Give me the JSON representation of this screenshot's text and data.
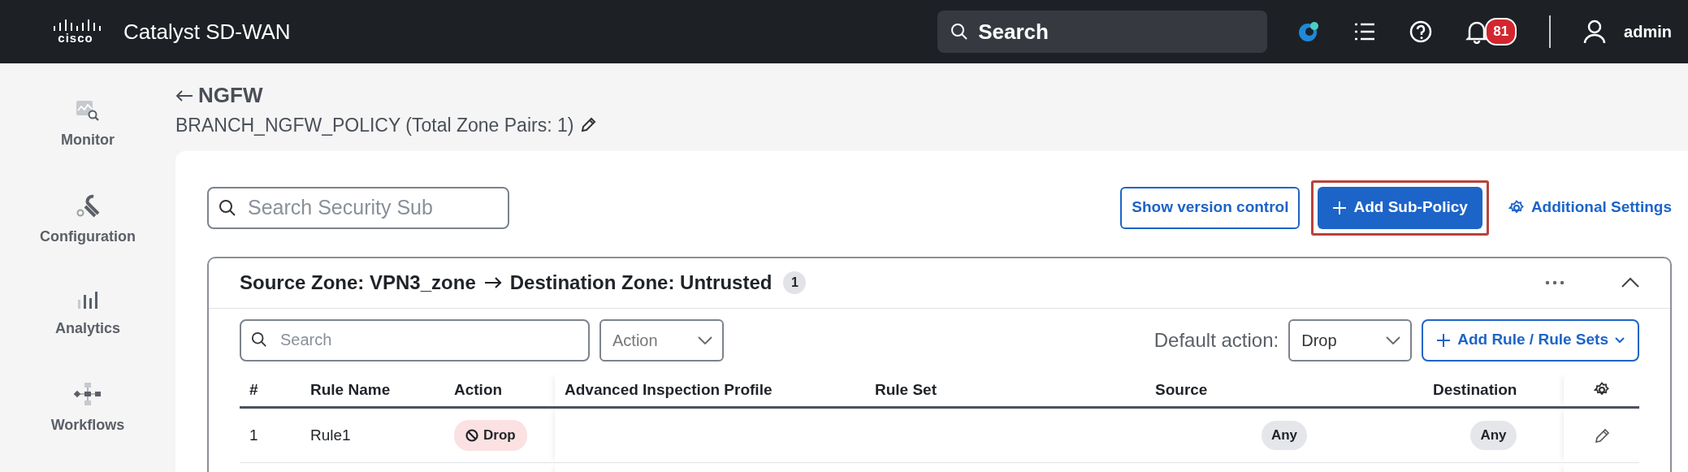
{
  "header": {
    "logo_text": "cisco",
    "brand": "Catalyst SD-WAN",
    "search_placeholder": "Search",
    "notifications": "81",
    "user": "admin"
  },
  "sidebar": {
    "items": [
      {
        "label": "Monitor",
        "kind": "monitor"
      },
      {
        "label": "Configuration",
        "kind": "configuration"
      },
      {
        "label": "Analytics",
        "kind": "analytics"
      },
      {
        "label": "Workflows",
        "kind": "workflows"
      }
    ]
  },
  "page": {
    "title": "NGFW",
    "subtitle": "BRANCH_NGFW_POLICY (Total Zone Pairs: 1)"
  },
  "toolbar": {
    "search_placeholder": "Search Security Sub",
    "buttons": [
      {
        "label": "Show version control",
        "kind": "outline",
        "highlighted": false
      },
      {
        "label": "Add Sub-Policy",
        "kind": "primary",
        "highlighted": true
      }
    ],
    "settings_link": "Additional Settings"
  },
  "zone_pair": {
    "source_label": "Source Zone: VPN3_zone",
    "destination_label": "Destination Zone: Untrusted",
    "count": "1",
    "expanded": true,
    "search_placeholder": "Search",
    "action_filter": "Action",
    "default_action_label": "Default action:",
    "default_action": "Drop",
    "add_button": "Add Rule / Rule Sets",
    "table": {
      "columns": [
        "#",
        "Rule Name",
        "Action",
        "Advanced Inspection Profile",
        "Rule Set",
        "Source",
        "Destination"
      ],
      "rows": [
        {
          "number": "1",
          "rule_name": "Rule1",
          "action": "Drop",
          "source": "Any",
          "destination": "Any"
        }
      ]
    }
  }
}
